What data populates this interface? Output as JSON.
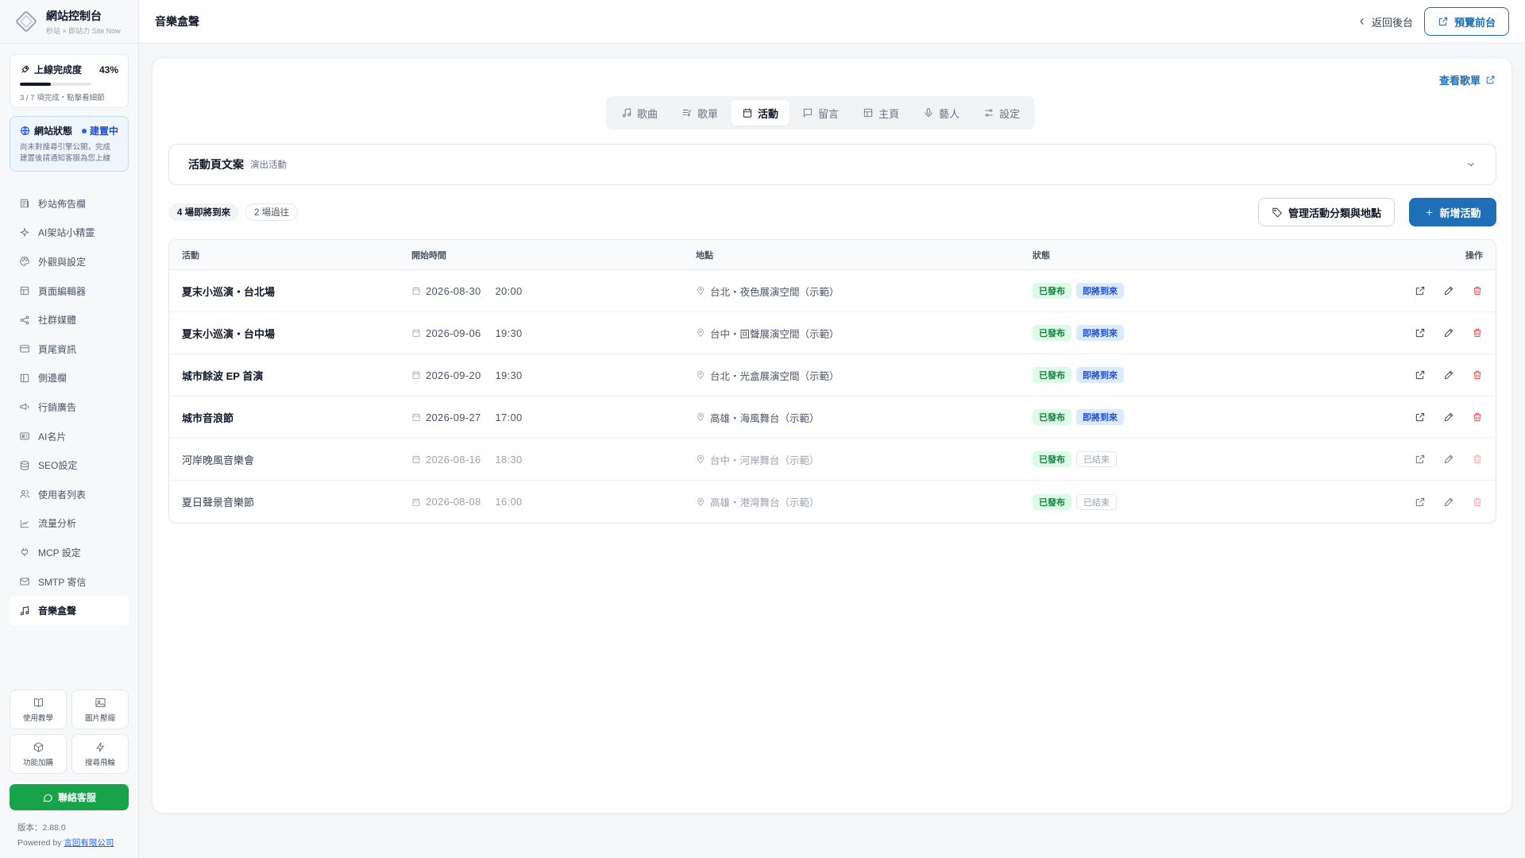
{
  "brand": {
    "title": "網站控制台",
    "subtitle": "秒站 × 即站力 Site Now"
  },
  "progress": {
    "label": "上線完成度",
    "percent_text": "43%",
    "fraction": 0.43,
    "hint": "3 / 7 項完成・點擊看細節"
  },
  "site_status": {
    "label": "網站狀態",
    "state": "建置中",
    "desc_line1": "尚未對搜尋引擎公開，完成",
    "desc_line2": "建置後請通知客服為您上線"
  },
  "nav": [
    {
      "label": "秒站佈告欄",
      "icon": "newspaper-icon"
    },
    {
      "label": "AI架站小精靈",
      "icon": "sparkle-icon"
    },
    {
      "label": "外觀與設定",
      "icon": "palette-icon"
    },
    {
      "label": "頁面編輯器",
      "icon": "layout-icon"
    },
    {
      "label": "社群媒體",
      "icon": "share-icon"
    },
    {
      "label": "頁尾資訊",
      "icon": "card-icon"
    },
    {
      "label": "側邊欄",
      "icon": "sidebar-icon"
    },
    {
      "label": "行銷廣告",
      "icon": "megaphone-icon"
    },
    {
      "label": "AI名片",
      "icon": "id-card-icon"
    },
    {
      "label": "SEO設定",
      "icon": "database-icon"
    },
    {
      "label": "使用者列表",
      "icon": "users-icon"
    },
    {
      "label": "流量分析",
      "icon": "chart-line-icon"
    },
    {
      "label": "MCP 設定",
      "icon": "plug-icon"
    },
    {
      "label": "SMTP 寄信",
      "icon": "mail-icon"
    },
    {
      "label": "音樂盒聲",
      "icon": "music-note-icon",
      "active": true
    }
  ],
  "tools": [
    {
      "label": "使用教學",
      "icon": "book-icon"
    },
    {
      "label": "圖片壓縮",
      "icon": "image-icon"
    },
    {
      "label": "功能加購",
      "icon": "box-icon"
    },
    {
      "label": "搜尋飛輪",
      "icon": "bolt-icon"
    }
  ],
  "contact_label": "聯絡客服",
  "version": "版本：2.88.0",
  "powered_prefix": "Powered by ",
  "powered_company": "言回有限公司",
  "topbar": {
    "title": "音樂盒聲",
    "back_label": "返回後台",
    "preview_label": "預覽前台"
  },
  "playlist_link": "查看歌單",
  "tabs": [
    {
      "label": "歌曲",
      "icon": "music-note-icon"
    },
    {
      "label": "歌單",
      "icon": "list-music-icon"
    },
    {
      "label": "活動",
      "icon": "calendar-icon",
      "active": true
    },
    {
      "label": "留言",
      "icon": "message-icon"
    },
    {
      "label": "主頁",
      "icon": "layout-icon"
    },
    {
      "label": "藝人",
      "icon": "mic-icon"
    },
    {
      "label": "設定",
      "icon": "sliders-icon"
    }
  ],
  "copy_section": {
    "title": "活動頁文案",
    "subtitle": "演出活動"
  },
  "pills": {
    "upcoming": "4 場即將到來",
    "past": "2 場過往"
  },
  "buttons": {
    "manage": "管理活動分類與地點",
    "add": "新增活動"
  },
  "table": {
    "headers": {
      "event": "活動",
      "start": "開始時間",
      "place": "地點",
      "status": "狀態",
      "actions": "操作"
    },
    "rows": [
      {
        "name": "夏末小巡演・台北場",
        "date": "2026-08-30",
        "time": "20:00",
        "place": "台北・夜色展演空間（示範）",
        "status": "已發布",
        "phase": "即將到來",
        "past": false
      },
      {
        "name": "夏末小巡演・台中場",
        "date": "2026-09-06",
        "time": "19:30",
        "place": "台中・回聲展演空間（示範）",
        "status": "已發布",
        "phase": "即將到來",
        "past": false
      },
      {
        "name": "城市餘波 EP 首演",
        "date": "2026-09-20",
        "time": "19:30",
        "place": "台北・光盒展演空間（示範）",
        "status": "已發布",
        "phase": "即將到來",
        "past": false
      },
      {
        "name": "城市音浪節",
        "date": "2026-09-27",
        "time": "17:00",
        "place": "高雄・海風舞台（示範）",
        "status": "已發布",
        "phase": "即將到來",
        "past": false
      },
      {
        "name": "河岸晚風音樂會",
        "date": "2026-08-16",
        "time": "18:30",
        "place": "台中・河岸舞台（示範）",
        "status": "已發布",
        "phase": "已結束",
        "past": true
      },
      {
        "name": "夏日聲景音樂節",
        "date": "2026-08-08",
        "time": "16:00",
        "place": "高雄・港灣舞台（示範）",
        "status": "已發布",
        "phase": "已結束",
        "past": true
      }
    ]
  }
}
